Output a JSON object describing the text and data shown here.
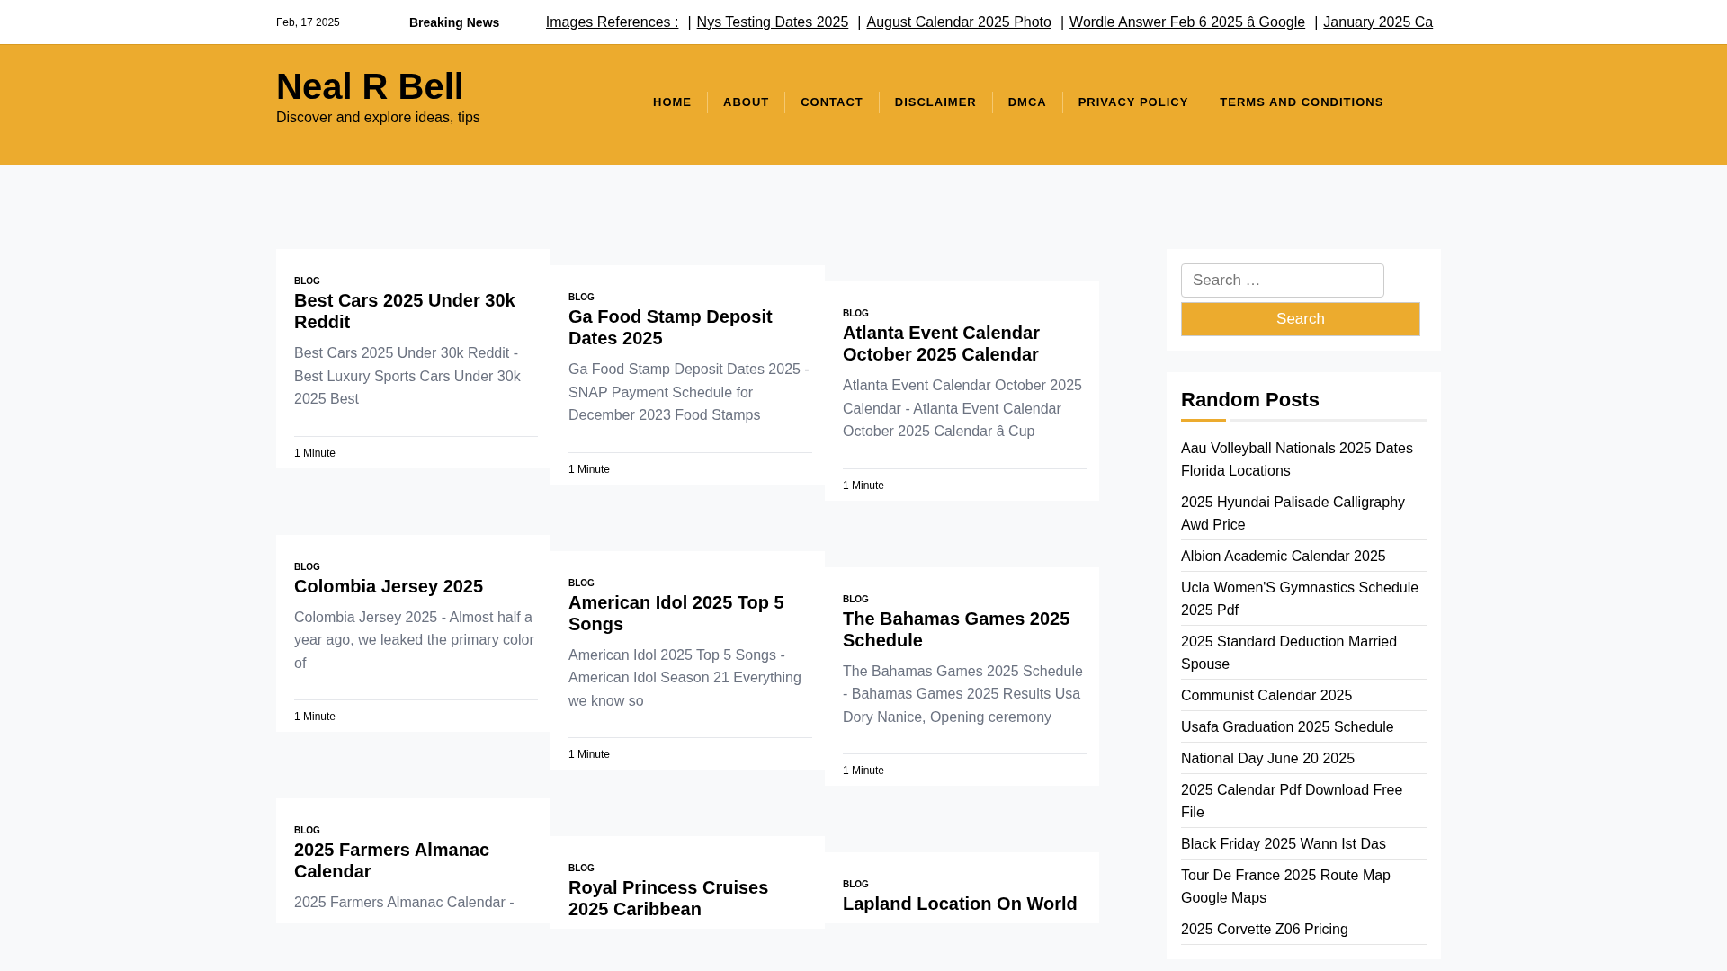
{
  "top_bar": {
    "date": "Feb, 17 2025",
    "breaking_label": "Breaking News",
    "ticker": [
      {
        "label": "Images References :"
      },
      {
        "separator": "|",
        "label": "Nys Testing Dates 2025"
      },
      {
        "separator": "|",
        "label": "August Calendar 2025 Photo"
      },
      {
        "separator": "|",
        "label": "Wordle Answer Feb 6 2025 â Google"
      },
      {
        "separator": "|",
        "label": "January 2025 Ca"
      }
    ]
  },
  "header": {
    "site_title": "Neal R Bell",
    "tagline": "Discover and explore ideas, tips",
    "nav": [
      "HOME",
      "ABOUT",
      "CONTACT",
      "DISCLAIMER",
      "DMCA",
      "PRIVACY POLICY",
      "TERMS AND CONDITIONS"
    ]
  },
  "posts": [
    [
      {
        "category": "BLOG",
        "title": "Best Cars 2025 Under 30k Reddit",
        "excerpt": "Best Cars 2025 Under 30k Reddit - Best Luxury Sports Cars Under 30k 2025 Best",
        "read_time": "1 Minute"
      },
      {
        "category": "BLOG",
        "title": "Colombia Jersey 2025",
        "excerpt": "Colombia Jersey 2025 - Almost half a year ago, we leaked the primary color of",
        "read_time": "1 Minute"
      },
      {
        "category": "BLOG",
        "title": "2025 Farmers Almanac Calendar",
        "excerpt": "2025 Farmers Almanac Calendar -"
      }
    ],
    [
      {
        "category": "BLOG",
        "title": "Ga Food Stamp Deposit Dates 2025",
        "excerpt": "Ga Food Stamp Deposit Dates 2025 - SNAP Payment Schedule for December 2023 Food Stamps",
        "read_time": "1 Minute"
      },
      {
        "category": "BLOG",
        "title": "American Idol 2025 Top 5 Songs",
        "excerpt": "American Idol 2025 Top 5 Songs - American Idol Season 21 Everything we know so",
        "read_time": "1 Minute"
      },
      {
        "category": "BLOG",
        "title": "Royal Princess Cruises 2025 Caribbean"
      }
    ],
    [
      {
        "category": "BLOG",
        "title": "Atlanta Event Calendar October 2025 Calendar",
        "excerpt": "Atlanta Event Calendar October 2025 Calendar - Atlanta Event Calendar October 2025 Calendar â Cup",
        "read_time": "1 Minute"
      },
      {
        "category": "BLOG",
        "title": "The Bahamas Games 2025 Schedule",
        "excerpt": "The Bahamas Games 2025 Schedule - Bahamas Games 2025 Results Usa Dory Nanice, Opening ceremony",
        "read_time": "1 Minute"
      },
      {
        "category": "BLOG",
        "title": "Lapland Location On World"
      }
    ]
  ],
  "sidebar": {
    "search": {
      "placeholder": "Search …",
      "button": "Search"
    },
    "random_posts": {
      "title": "Random Posts",
      "items": [
        "Aau Volleyball Nationals 2025 Dates Florida Locations",
        "2025 Hyundai Palisade Calligraphy Awd Price",
        "Albion Academic Calendar 2025",
        "Ucla Women'S Gymnastics Schedule 2025 Pdf",
        "2025 Standard Deduction Married Spouse",
        "Communist Calendar 2025",
        "Usafa Graduation 2025 Schedule",
        "National Day June 20 2025",
        "2025 Calendar Pdf Download Free File",
        "Black Friday 2025 Wann Ist Das",
        "Tour De France 2025 Route Map Google Maps",
        "2025 Corvette Z06 Pricing"
      ]
    }
  }
}
